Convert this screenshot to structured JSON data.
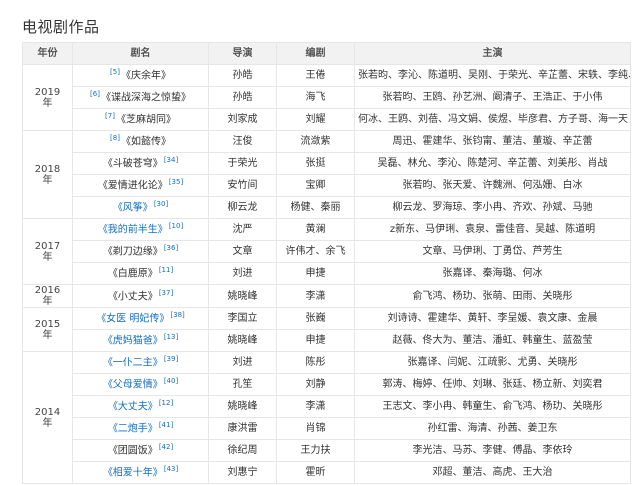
{
  "section_title": "电视剧作品",
  "headers": [
    "年份",
    "剧名",
    "导演",
    "编剧",
    "主演"
  ],
  "rows": [
    {
      "year": "2019\n年",
      "span": 3,
      "ref": "[5]",
      "ref_pos": "before",
      "title": "《庆余年》",
      "linked": false,
      "director": "孙皓",
      "writer": "王倦",
      "cast": "张若昀、李沁、陈道明、吴刚、于荣光、辛芷蕾、宋轶、李纯、肖战"
    },
    {
      "ref": "[6]",
      "ref_pos": "before",
      "title": "《谍战深海之惊蛰》",
      "linked": false,
      "director": "孙皓",
      "writer": "海飞",
      "cast": "张若昀、王鸥、孙艺洲、阚清子、王浩正、于小伟"
    },
    {
      "ref": "[7]",
      "ref_pos": "before",
      "title": "《芝麻胡同》",
      "linked": false,
      "director": "刘家成",
      "writer": "刘耀",
      "cast": "何冰、王鸥、刘蓓、冯文娟、侯煜、毕彦君、方子哥、海一天"
    },
    {
      "year": "2018\n年",
      "span": 4,
      "ref": "[8]",
      "ref_pos": "before",
      "title": "《如懿传》",
      "linked": false,
      "director": "汪俊",
      "writer": "流潋紫",
      "cast": "周迅、霍建华、张钧甯、董洁、董璇、辛芷蕾"
    },
    {
      "ref": "[34]",
      "ref_pos": "after",
      "title": "《斗破苍穹》",
      "linked": false,
      "director": "于荣光",
      "writer": "张挺",
      "cast": "吴磊、林允、李沁、陈楚河、辛芷蕾、刘美彤、肖战"
    },
    {
      "ref": "[35]",
      "ref_pos": "after",
      "title": "《爱情进化论》",
      "linked": false,
      "director": "安竹间",
      "writer": "宝卿",
      "cast": "张若昀、张天爱、许魏洲、何泓姗、白冰"
    },
    {
      "ref": "[30]",
      "ref_pos": "after",
      "title": "《风筝》",
      "linked": true,
      "director": "柳云龙",
      "writer": "杨健、秦丽",
      "cast": "柳云龙、罗海琼、李小冉、齐欢、孙斌、马驰"
    },
    {
      "year": "2017\n年",
      "span": 3,
      "ref": "[10]",
      "ref_pos": "after",
      "title": "《我的前半生》",
      "linked": true,
      "director": "沈严",
      "writer": "黄澜",
      "cast": "z新东、马伊琍、袁泉、雷佳音、吴越、陈道明"
    },
    {
      "ref": "[36]",
      "ref_pos": "after",
      "title": "《剃刀边缘》",
      "linked": false,
      "director": "文章",
      "writer": "许伟才、余飞",
      "cast": "文章、马伊琍、丁勇岱、芦芳生"
    },
    {
      "ref": "[11]",
      "ref_pos": "after",
      "title": "《白鹿原》",
      "linked": false,
      "director": "刘进",
      "writer": "申捷",
      "cast": "张嘉译、秦海璐、何冰"
    },
    {
      "year": "2016\n年",
      "span": 1,
      "ref": "[37]",
      "ref_pos": "after",
      "title": "《小丈夫》",
      "linked": false,
      "director": "姚晓峰",
      "writer": "李潇",
      "cast": "俞飞鸿、杨玏、张萌、田雨、关晓彤"
    },
    {
      "year": "2015\n年",
      "span": 2,
      "ref": "[38]",
      "ref_pos": "after",
      "title": "《女医 明妃传》",
      "linked": true,
      "director": "李国立",
      "writer": "张巍",
      "cast": "刘诗诗、霍建华、黄轩、李呈媛、袁文康、金晨"
    },
    {
      "ref": "[13]",
      "ref_pos": "after",
      "title": "《虎妈猫爸》",
      "linked": true,
      "director": "姚晓峰",
      "writer": "申捷",
      "cast": "赵薇、佟大为、董洁、潘虹、韩童生、蓝盈莹"
    },
    {
      "year": "2014\n年",
      "span": 6,
      "ref": "[39]",
      "ref_pos": "after",
      "title": "《一仆二主》",
      "linked": true,
      "director": "刘进",
      "writer": "陈彤",
      "cast": "张嘉译、闫妮、江疏影、尤勇、关晓彤"
    },
    {
      "ref": "[40]",
      "ref_pos": "after",
      "title": "《父母爱情》",
      "linked": true,
      "director": "孔笙",
      "writer": "刘静",
      "cast": "郭涛、梅婷、任帅、刘琳、张廷、杨立新、刘奕君"
    },
    {
      "ref": "[12]",
      "ref_pos": "after",
      "title": "《大丈夫》",
      "linked": true,
      "director": "姚晓峰",
      "writer": "李潇",
      "cast": "王志文、李小冉、韩童生、俞飞鸿、杨玏、关晓彤"
    },
    {
      "ref": "[41]",
      "ref_pos": "after",
      "title": "《二炮手》",
      "linked": true,
      "director": "康洪雷",
      "writer": "肖锦",
      "cast": "孙红雷、海清、孙茜、姜卫东"
    },
    {
      "ref": "[42]",
      "ref_pos": "after",
      "title": "《团圆饭》",
      "linked": false,
      "director": "徐纪周",
      "writer": "王力扶",
      "cast": "李光洁、马苏、李健、傅晶、李依玲"
    },
    {
      "ref": "[43]",
      "ref_pos": "after",
      "title": "《相爱十年》",
      "linked": true,
      "director": "刘惠宁",
      "writer": "霍昕",
      "cast": "邓超、董洁、高虎、王大治"
    }
  ]
}
